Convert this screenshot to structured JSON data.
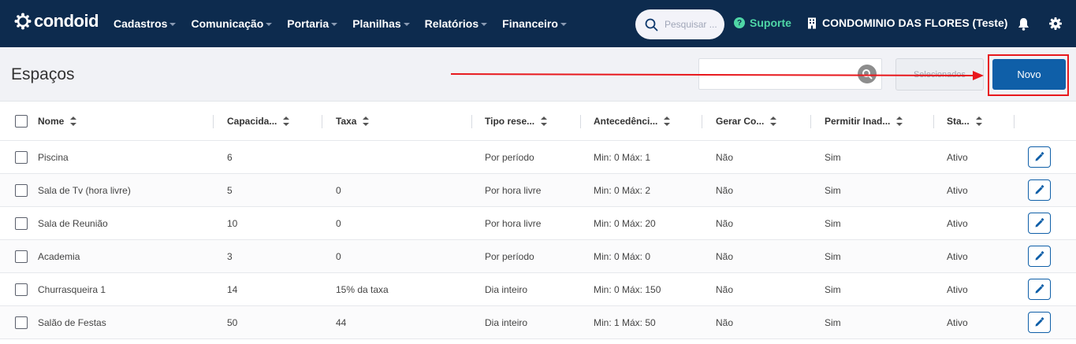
{
  "navbar": {
    "brand": "condoid",
    "menu": [
      {
        "label": "Cadastros"
      },
      {
        "label": "Comunicação"
      },
      {
        "label": "Portaria"
      },
      {
        "label": "Planilhas"
      },
      {
        "label": "Relatórios"
      },
      {
        "label": "Financeiro"
      }
    ],
    "search_placeholder": "Pesquisar ...",
    "support_label": "Suporte",
    "condo_name": "CONDOMINIO DAS FLORES (Teste)"
  },
  "page": {
    "title": "Espaços",
    "selected_label": "Selecionados",
    "new_label": "Novo"
  },
  "table": {
    "columns": [
      "Nome",
      "Capacida...",
      "Taxa",
      "Tipo rese...",
      "Antecedênci...",
      "Gerar Co...",
      "Permitir Inad...",
      "Sta..."
    ],
    "rows": [
      [
        "Piscina",
        "6",
        "",
        "Por período",
        "Min: 0 Máx: 1",
        "Não",
        "Sim",
        "Ativo"
      ],
      [
        "Sala de Tv (hora livre)",
        "5",
        "0",
        "Por hora livre",
        "Min: 0 Máx: 2",
        "Não",
        "Sim",
        "Ativo"
      ],
      [
        "Sala de Reunião",
        "10",
        "0",
        "Por hora livre",
        "Min: 0 Máx: 20",
        "Não",
        "Sim",
        "Ativo"
      ],
      [
        "Academia",
        "3",
        "0",
        "Por período",
        "Min: 0 Máx: 0",
        "Não",
        "Sim",
        "Ativo"
      ],
      [
        "Churrasqueira 1",
        "14",
        "15% da taxa",
        "Dia inteiro",
        "Min: 0 Máx: 150",
        "Não",
        "Sim",
        "Ativo"
      ],
      [
        "Salão de Festas",
        "50",
        "44",
        "Dia inteiro",
        "Min: 1 Máx: 50",
        "Não",
        "Sim",
        "Ativo"
      ]
    ]
  },
  "colors": {
    "navbar_bg": "#0d2b4e",
    "accent": "#0f5fa8",
    "support": "#4fd6a6",
    "annotation": "#e8181d"
  },
  "icons": {
    "search": "search-icon",
    "help": "help-circle-icon",
    "building": "building-icon",
    "bell": "bell-icon",
    "gear": "gear-icon",
    "edit": "pencil-icon"
  }
}
